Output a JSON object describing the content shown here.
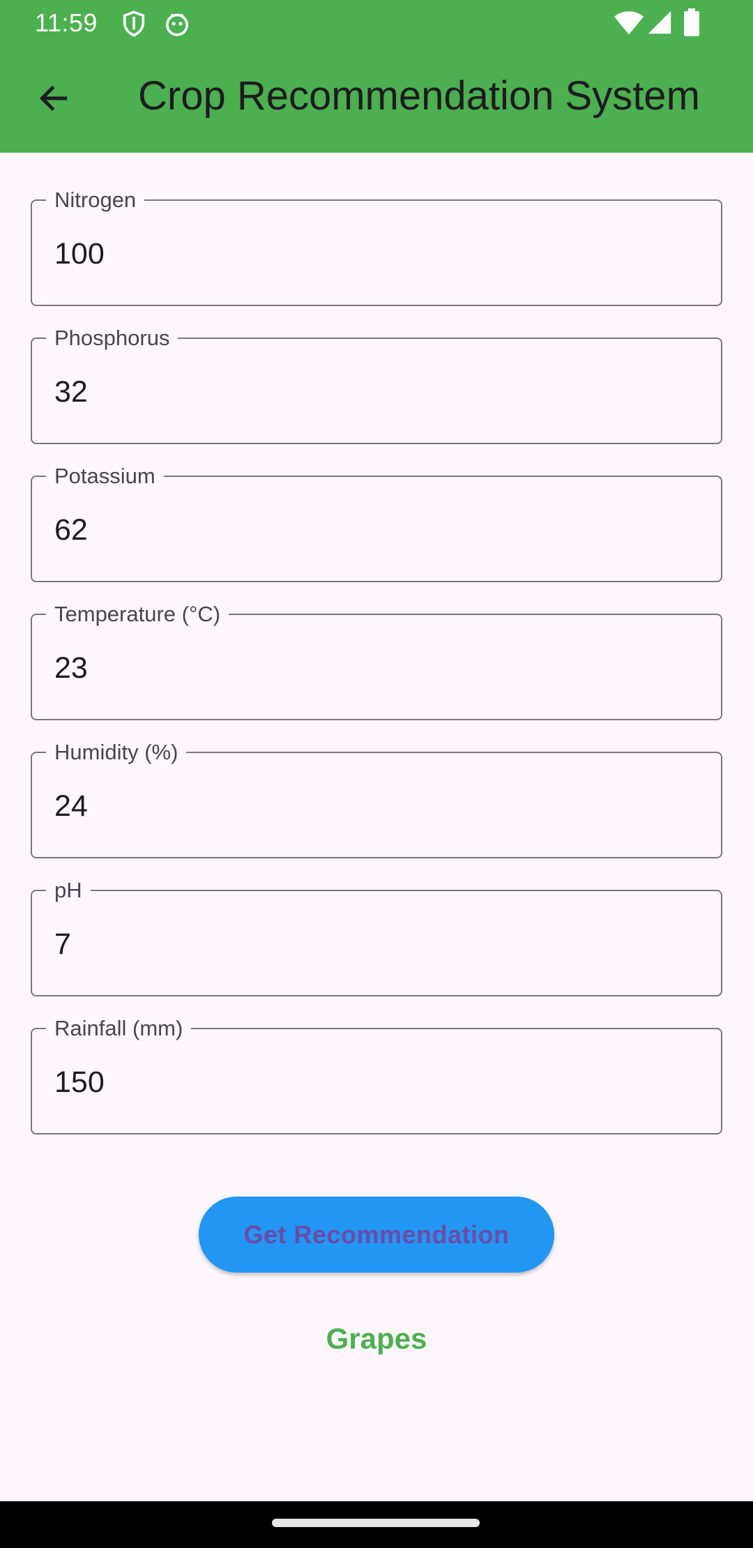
{
  "status_bar": {
    "time": "11:59"
  },
  "app_bar": {
    "title": "Crop Recommendation System"
  },
  "form": {
    "fields": [
      {
        "label": "Nitrogen",
        "value": "100"
      },
      {
        "label": "Phosphorus",
        "value": "32"
      },
      {
        "label": "Potassium",
        "value": "62"
      },
      {
        "label": "Temperature (°C)",
        "value": "23"
      },
      {
        "label": "Humidity (%)",
        "value": "24"
      },
      {
        "label": "pH",
        "value": "7"
      },
      {
        "label": "Rainfall (mm)",
        "value": "150"
      }
    ]
  },
  "actions": {
    "recommend_label": "Get Recommendation"
  },
  "result": {
    "crop": "Grapes"
  },
  "icons": {
    "back": "arrow-back-icon",
    "status": [
      "vpn-shield-icon",
      "android-bot-icon",
      "wifi-icon",
      "cell-signal-icon",
      "battery-icon"
    ]
  },
  "colors": {
    "app_bar": "#4caf50",
    "button": "#2196f3",
    "button_text": "#6e4aa8",
    "result_text": "#4caf50",
    "background": "#fdf7fd"
  }
}
